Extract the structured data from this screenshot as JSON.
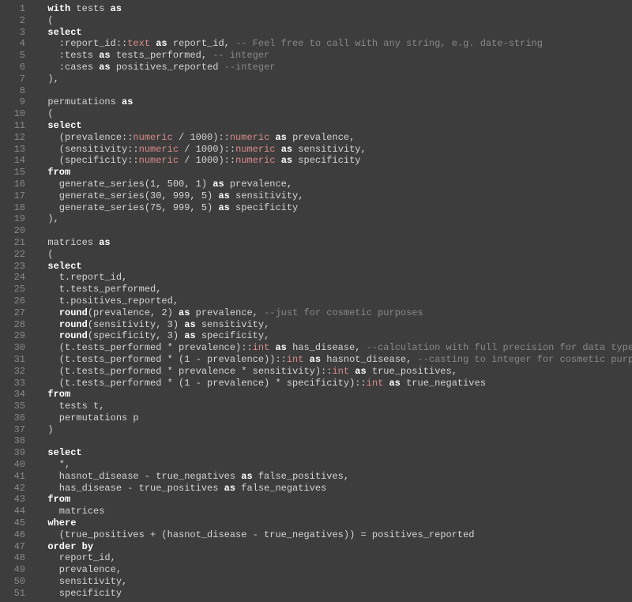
{
  "gutter": {
    "start": 1,
    "end": 51
  },
  "code": {
    "lines": [
      [
        [
          "plain",
          "  "
        ],
        [
          "kw",
          "with"
        ],
        [
          "plain",
          " tests "
        ],
        [
          "kw",
          "as"
        ]
      ],
      [
        [
          "plain",
          "  ("
        ]
      ],
      [
        [
          "plain",
          "  "
        ],
        [
          "kw",
          "select"
        ]
      ],
      [
        [
          "plain",
          "    :report_id::"
        ],
        [
          "type",
          "text"
        ],
        [
          "plain",
          " "
        ],
        [
          "kw",
          "as"
        ],
        [
          "plain",
          " report_id, "
        ],
        [
          "cmnt",
          "-- Feel free to call with any string, e.g. date-string"
        ]
      ],
      [
        [
          "plain",
          "    :tests "
        ],
        [
          "kw",
          "as"
        ],
        [
          "plain",
          " tests_performed, "
        ],
        [
          "cmnt",
          "-- integer"
        ]
      ],
      [
        [
          "plain",
          "    :cases "
        ],
        [
          "kw",
          "as"
        ],
        [
          "plain",
          " positives_reported "
        ],
        [
          "cmnt",
          "--integer"
        ]
      ],
      [
        [
          "plain",
          "  ),"
        ]
      ],
      [
        [
          "plain",
          ""
        ]
      ],
      [
        [
          "plain",
          "  permutations "
        ],
        [
          "kw",
          "as"
        ]
      ],
      [
        [
          "plain",
          "  ("
        ]
      ],
      [
        [
          "plain",
          "  "
        ],
        [
          "kw",
          "select"
        ]
      ],
      [
        [
          "plain",
          "    (prevalence::"
        ],
        [
          "type",
          "numeric"
        ],
        [
          "plain",
          " / 1000)::"
        ],
        [
          "type",
          "numeric"
        ],
        [
          "plain",
          " "
        ],
        [
          "kw",
          "as"
        ],
        [
          "plain",
          " prevalence,"
        ]
      ],
      [
        [
          "plain",
          "    (sensitivity::"
        ],
        [
          "type",
          "numeric"
        ],
        [
          "plain",
          " / 1000)::"
        ],
        [
          "type",
          "numeric"
        ],
        [
          "plain",
          " "
        ],
        [
          "kw",
          "as"
        ],
        [
          "plain",
          " sensitivity,"
        ]
      ],
      [
        [
          "plain",
          "    (specificity::"
        ],
        [
          "type",
          "numeric"
        ],
        [
          "plain",
          " / 1000)::"
        ],
        [
          "type",
          "numeric"
        ],
        [
          "plain",
          " "
        ],
        [
          "kw",
          "as"
        ],
        [
          "plain",
          " specificity"
        ]
      ],
      [
        [
          "plain",
          "  "
        ],
        [
          "kw",
          "from"
        ]
      ],
      [
        [
          "plain",
          "    generate_series(1, 500, 1) "
        ],
        [
          "kw",
          "as"
        ],
        [
          "plain",
          " prevalence,"
        ]
      ],
      [
        [
          "plain",
          "    generate_series(30, 999, 5) "
        ],
        [
          "kw",
          "as"
        ],
        [
          "plain",
          " sensitivity,"
        ]
      ],
      [
        [
          "plain",
          "    generate_series(75, 999, 5) "
        ],
        [
          "kw",
          "as"
        ],
        [
          "plain",
          " specificity"
        ]
      ],
      [
        [
          "plain",
          "  ),"
        ]
      ],
      [
        [
          "plain",
          ""
        ]
      ],
      [
        [
          "plain",
          "  matrices "
        ],
        [
          "kw",
          "as"
        ]
      ],
      [
        [
          "plain",
          "  ("
        ]
      ],
      [
        [
          "plain",
          "  "
        ],
        [
          "kw",
          "select"
        ]
      ],
      [
        [
          "plain",
          "    t.report_id,"
        ]
      ],
      [
        [
          "plain",
          "    t.tests_performed,"
        ]
      ],
      [
        [
          "plain",
          "    t.positives_reported,"
        ]
      ],
      [
        [
          "plain",
          "    "
        ],
        [
          "kw",
          "round"
        ],
        [
          "plain",
          "(prevalence, 2) "
        ],
        [
          "kw",
          "as"
        ],
        [
          "plain",
          " prevalence, "
        ],
        [
          "cmnt",
          "--just for cosmetic purposes"
        ]
      ],
      [
        [
          "plain",
          "    "
        ],
        [
          "kw",
          "round"
        ],
        [
          "plain",
          "(sensitivity, 3) "
        ],
        [
          "kw",
          "as"
        ],
        [
          "plain",
          " sensitivity,"
        ]
      ],
      [
        [
          "plain",
          "    "
        ],
        [
          "kw",
          "round"
        ],
        [
          "plain",
          "(specificity, 3) "
        ],
        [
          "kw",
          "as"
        ],
        [
          "plain",
          " specificity,"
        ]
      ],
      [
        [
          "plain",
          "    (t.tests_performed * prevalence)::"
        ],
        [
          "type",
          "int"
        ],
        [
          "plain",
          " "
        ],
        [
          "kw",
          "as"
        ],
        [
          "plain",
          " has_disease, "
        ],
        [
          "cmnt",
          "--calculation with full precision for data type numeric, but"
        ]
      ],
      [
        [
          "plain",
          "    (t.tests_performed * (1 - prevalence))::"
        ],
        [
          "type",
          "int"
        ],
        [
          "plain",
          " "
        ],
        [
          "kw",
          "as"
        ],
        [
          "plain",
          " hasnot_disease, "
        ],
        [
          "cmnt",
          "--casting to integer for cosmetic purposes"
        ]
      ],
      [
        [
          "plain",
          "    (t.tests_performed * prevalence * sensitivity)::"
        ],
        [
          "type",
          "int"
        ],
        [
          "plain",
          " "
        ],
        [
          "kw",
          "as"
        ],
        [
          "plain",
          " true_positives,"
        ]
      ],
      [
        [
          "plain",
          "    (t.tests_performed * (1 - prevalence) * specificity)::"
        ],
        [
          "type",
          "int"
        ],
        [
          "plain",
          " "
        ],
        [
          "kw",
          "as"
        ],
        [
          "plain",
          " true_negatives"
        ]
      ],
      [
        [
          "plain",
          "  "
        ],
        [
          "kw",
          "from"
        ]
      ],
      [
        [
          "plain",
          "    tests t,"
        ]
      ],
      [
        [
          "plain",
          "    permutations p"
        ]
      ],
      [
        [
          "plain",
          "  )"
        ]
      ],
      [
        [
          "plain",
          ""
        ]
      ],
      [
        [
          "plain",
          "  "
        ],
        [
          "kw",
          "select"
        ]
      ],
      [
        [
          "plain",
          "    *,"
        ]
      ],
      [
        [
          "plain",
          "    hasnot_disease - true_negatives "
        ],
        [
          "kw",
          "as"
        ],
        [
          "plain",
          " false_positives,"
        ]
      ],
      [
        [
          "plain",
          "    has_disease - true_positives "
        ],
        [
          "kw",
          "as"
        ],
        [
          "plain",
          " false_negatives"
        ]
      ],
      [
        [
          "plain",
          "  "
        ],
        [
          "kw",
          "from"
        ]
      ],
      [
        [
          "plain",
          "    matrices"
        ]
      ],
      [
        [
          "plain",
          "  "
        ],
        [
          "kw",
          "where"
        ]
      ],
      [
        [
          "plain",
          "    (true_positives + (hasnot_disease - true_negatives)) = positives_reported"
        ]
      ],
      [
        [
          "plain",
          "  "
        ],
        [
          "kw",
          "order by"
        ]
      ],
      [
        [
          "plain",
          "    report_id,"
        ]
      ],
      [
        [
          "plain",
          "    prevalence,"
        ]
      ],
      [
        [
          "plain",
          "    sensitivity,"
        ]
      ],
      [
        [
          "plain",
          "    specificity"
        ]
      ]
    ]
  }
}
